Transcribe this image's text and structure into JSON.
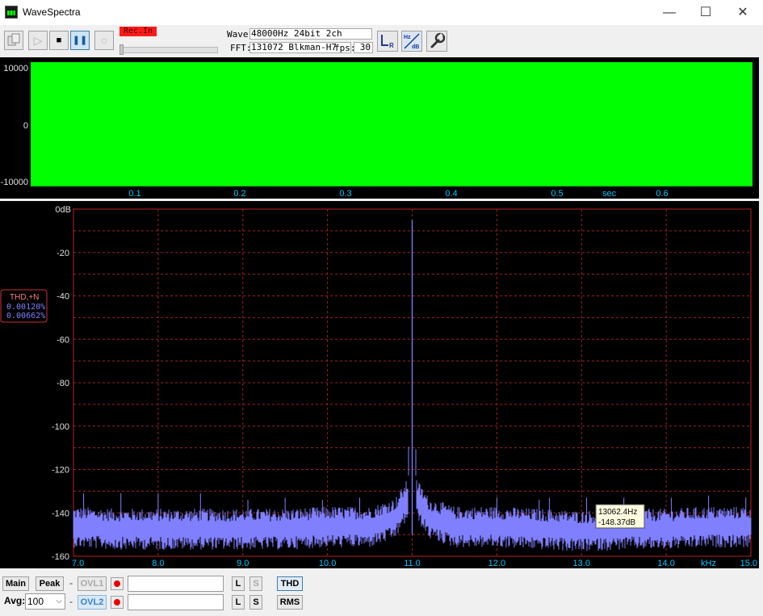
{
  "window": {
    "title": "WaveSpectra",
    "minimize": "—",
    "maximize": "☐",
    "close": "✕"
  },
  "toolbar": {
    "rec_in_label": "Rec.In",
    "wave_label": "Wave:",
    "wave_value": "48000Hz 24bit 2ch",
    "fft_label": "FFT:",
    "fft_value": "131072 Blkman-H7",
    "fps_label": "fps:",
    "fps_value": "30",
    "icons": {
      "open": "open-file-icon",
      "play": "▷",
      "stop": "■",
      "pause": "❚❚",
      "record": "○"
    }
  },
  "waveform": {
    "color": "#00ff00",
    "y_ticks": [
      "10000",
      "0",
      "-10000"
    ],
    "x_ticks": [
      "0.1",
      "0.2",
      "0.3",
      "0.4",
      "0.5",
      "0.6"
    ],
    "x_unit": "sec"
  },
  "spectrum": {
    "y_ticks": [
      "0dB",
      "-20",
      "-40",
      "-60",
      "-80",
      "-100",
      "-120",
      "-140",
      "-160"
    ],
    "x_ticks": [
      "7.0",
      "8.0",
      "9.0",
      "10.0",
      "11.0",
      "12.0",
      "13.0",
      "14.0",
      "15.0"
    ],
    "x_unit": "kHz",
    "thd_label": "THD,+N",
    "thd_value": "0.00120%",
    "thdn_value": "0.00662%",
    "cursor_freq": "13062.4Hz",
    "cursor_level": "-148.37dB"
  },
  "chart_data": {
    "type": "line",
    "title": "",
    "xlabel": "kHz",
    "ylabel": "",
    "xlim": [
      7.0,
      15.0
    ],
    "ylim": [
      -160,
      0
    ],
    "grid": true,
    "series": [
      {
        "color": "#8080ff",
        "x": [
          7.0,
          7.5,
          8.0,
          8.5,
          9.0,
          9.5,
          10.0,
          10.5,
          10.8,
          10.95,
          11.0,
          11.05,
          11.2,
          11.5,
          12.0,
          12.5,
          13.0,
          13.5,
          14.0,
          14.5,
          15.0
        ],
        "y": [
          -146,
          -147,
          -147,
          -147,
          -147,
          -147,
          -146,
          -146,
          -142,
          -133,
          -5,
          -133,
          -142,
          -146,
          -146,
          -147,
          -148,
          -147,
          -147,
          -146,
          -146
        ]
      }
    ],
    "harmonic_spurs": [
      {
        "x": 7.12,
        "y": -131
      },
      {
        "x": 7.56,
        "y": -131
      },
      {
        "x": 8.0,
        "y": -131
      },
      {
        "x": 8.5,
        "y": -131
      },
      {
        "x": 9.06,
        "y": -134
      },
      {
        "x": 9.5,
        "y": -133
      },
      {
        "x": 9.94,
        "y": -134
      },
      {
        "x": 10.38,
        "y": -133
      },
      {
        "x": 12.0,
        "y": -133
      },
      {
        "x": 12.5,
        "y": -134
      },
      {
        "x": 12.62,
        "y": -133
      },
      {
        "x": 13.06,
        "y": -133
      },
      {
        "x": 13.5,
        "y": -133
      },
      {
        "x": 14.06,
        "y": -133
      },
      {
        "x": 14.5,
        "y": -132
      },
      {
        "x": 14.94,
        "y": -133
      }
    ]
  },
  "bottom": {
    "main_label": "Main",
    "peak_label": "Peak",
    "ovl1_label": "OVL1",
    "ovl2_label": "OVL2",
    "l_label": "L",
    "s_label": "S",
    "thd_label": "THD",
    "rms_label": "RMS",
    "avg_label": "Avg:",
    "avg_value": "100",
    "dash": "-"
  }
}
